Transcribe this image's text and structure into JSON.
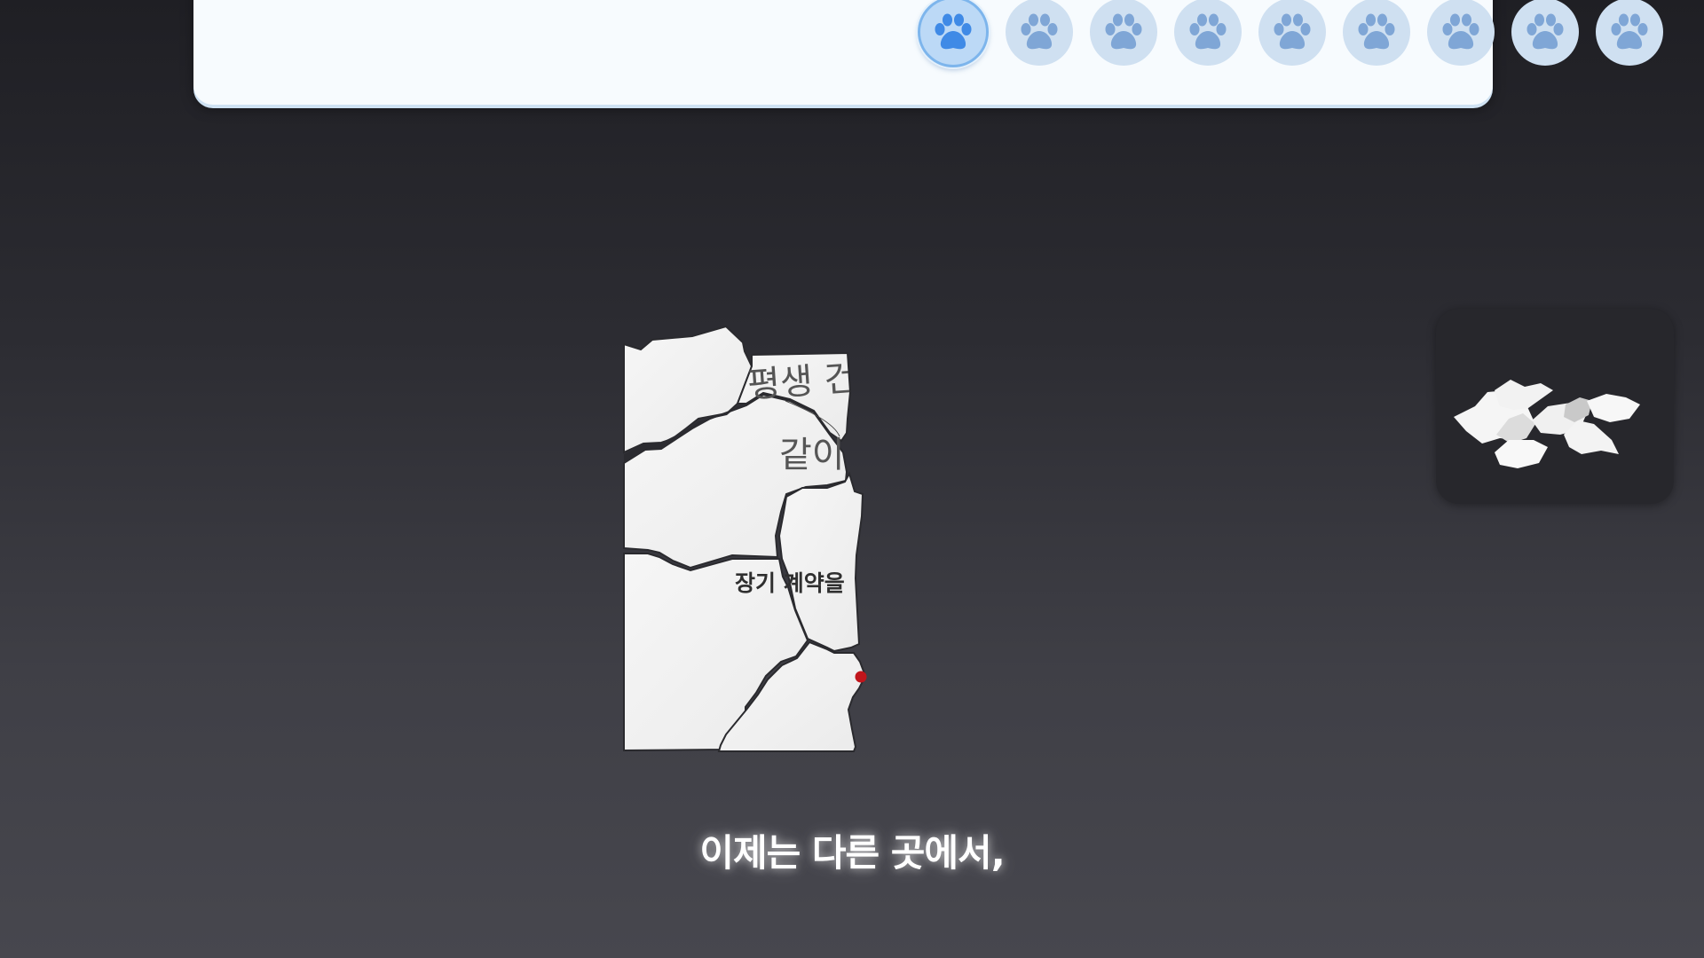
{
  "level_select": {
    "active_index": 0,
    "levels": [
      {
        "icon": "paw-icon",
        "state": "active"
      },
      {
        "icon": "paw-icon",
        "state": "inactive"
      },
      {
        "icon": "paw-icon",
        "state": "inactive"
      },
      {
        "icon": "paw-icon",
        "state": "inactive"
      },
      {
        "icon": "paw-icon",
        "state": "inactive"
      },
      {
        "icon": "paw-icon",
        "state": "inactive"
      },
      {
        "icon": "paw-icon",
        "state": "inactive"
      },
      {
        "icon": "paw-icon",
        "state": "inactive"
      },
      {
        "icon": "paw-icon",
        "state": "inactive"
      }
    ]
  },
  "paper": {
    "line1": "평생 건",
    "line2": "같이",
    "line3": "장기 계약을"
  },
  "subtitle": "이제는 다른 곳에서,",
  "colors": {
    "background_top": "#1f1f24",
    "background_bottom": "#47474e",
    "bar_background": "#f7fbfe",
    "paw_active": "#3f8ae6",
    "paw_inactive": "#7fa6d6",
    "seal_red": "#c0151b"
  }
}
